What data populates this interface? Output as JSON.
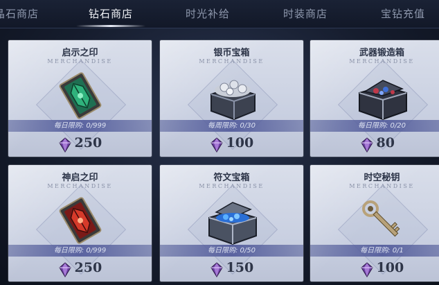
{
  "tabs": [
    {
      "label": "晶石商店",
      "active": false
    },
    {
      "label": "钻石商店",
      "active": true
    },
    {
      "label": "时光补给",
      "active": false
    },
    {
      "label": "时装商店",
      "active": false
    },
    {
      "label": "宝钻充值",
      "active": false
    }
  ],
  "items": [
    {
      "name": "启示之印",
      "subtitle": "MERCHANDISE",
      "limit": "每日限购: 0/999",
      "price": "250",
      "icon": "green-seal-icon"
    },
    {
      "name": "银币宝箱",
      "subtitle": "MERCHANDISE",
      "limit": "每周限购: 0/30",
      "price": "100",
      "icon": "silver-coin-chest-icon"
    },
    {
      "name": "武器锻造箱",
      "subtitle": "MERCHANDISE",
      "limit": "每日限购: 0/20",
      "price": "80",
      "icon": "weapon-forge-chest-icon"
    },
    {
      "name": "神启之印",
      "subtitle": "MERCHANDISE",
      "limit": "每日限购: 0/999",
      "price": "250",
      "icon": "red-seal-icon"
    },
    {
      "name": "符文宝箱",
      "subtitle": "MERCHANDISE",
      "limit": "每日限购: 0/50",
      "price": "150",
      "icon": "rune-chest-icon"
    },
    {
      "name": "时空秘钥",
      "subtitle": "MERCHANDISE",
      "limit": "每日限购: 0/1",
      "price": "100",
      "icon": "spacetime-key-icon"
    }
  ],
  "currency_icon": "purple-diamond-icon",
  "colors": {
    "card_bg": "#d3d8e6",
    "limit_bar": "#5a63a0",
    "price_text": "#2e3548",
    "active_tab": "#f2f4f8"
  }
}
